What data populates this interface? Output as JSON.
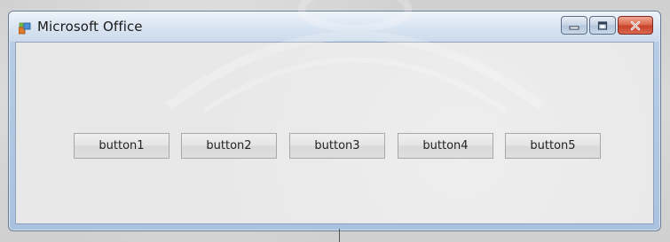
{
  "window": {
    "title": "Microsoft Office",
    "icon": "windows-forms-icon",
    "caption_buttons": [
      "minimize-icon",
      "maximize-icon",
      "close-icon"
    ]
  },
  "buttons": [
    {
      "label": "button1"
    },
    {
      "label": "button2"
    },
    {
      "label": "button3"
    },
    {
      "label": "button4"
    },
    {
      "label": "button5"
    }
  ],
  "colors": {
    "close_button": "#d0482f",
    "frame": "#b7cde6",
    "client_background": "#e8e8e8"
  }
}
